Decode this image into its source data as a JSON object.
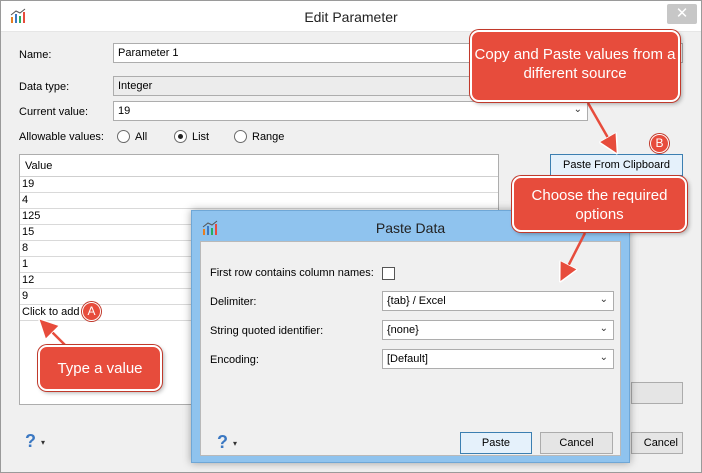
{
  "window": {
    "title": "Edit Parameter",
    "close": "✕"
  },
  "form": {
    "name_label": "Name:",
    "name_value": "Parameter 1",
    "datatype_label": "Data type:",
    "datatype_value": "Integer",
    "current_label": "Current value:",
    "current_value": "19",
    "allowable_label": "Allowable values:",
    "allowable_options": [
      "All",
      "List",
      "Range"
    ],
    "allowable_selected": "List"
  },
  "values_table": {
    "header": "Value",
    "rows": [
      "19",
      "4",
      "125",
      "15",
      "8",
      "1",
      "12",
      "9"
    ],
    "add_placeholder": "Click to add"
  },
  "buttons": {
    "paste_clipboard": "Paste From Clipboard",
    "cancel_partial": "Cancel",
    "help": "?"
  },
  "paste_dialog": {
    "title": "Paste Data",
    "first_row_label": "First row contains column names:",
    "delimiter_label": "Delimiter:",
    "delimiter_value": "{tab} / Excel",
    "quote_label": "String quoted identifier:",
    "quote_value": "{none}",
    "encoding_label": "Encoding:",
    "encoding_value": "[Default]",
    "paste_button": "Paste",
    "cancel_button": "Cancel",
    "help": "?"
  },
  "callouts": {
    "copy_paste": "Copy and Paste values from a different source",
    "choose_options": "Choose the required options",
    "type_value": "Type a value",
    "marker_a": "A",
    "marker_b": "B"
  },
  "colors": {
    "callout": "#e74c3c",
    "dialog_frame": "#8fc3ee",
    "help": "#3b78c2"
  }
}
